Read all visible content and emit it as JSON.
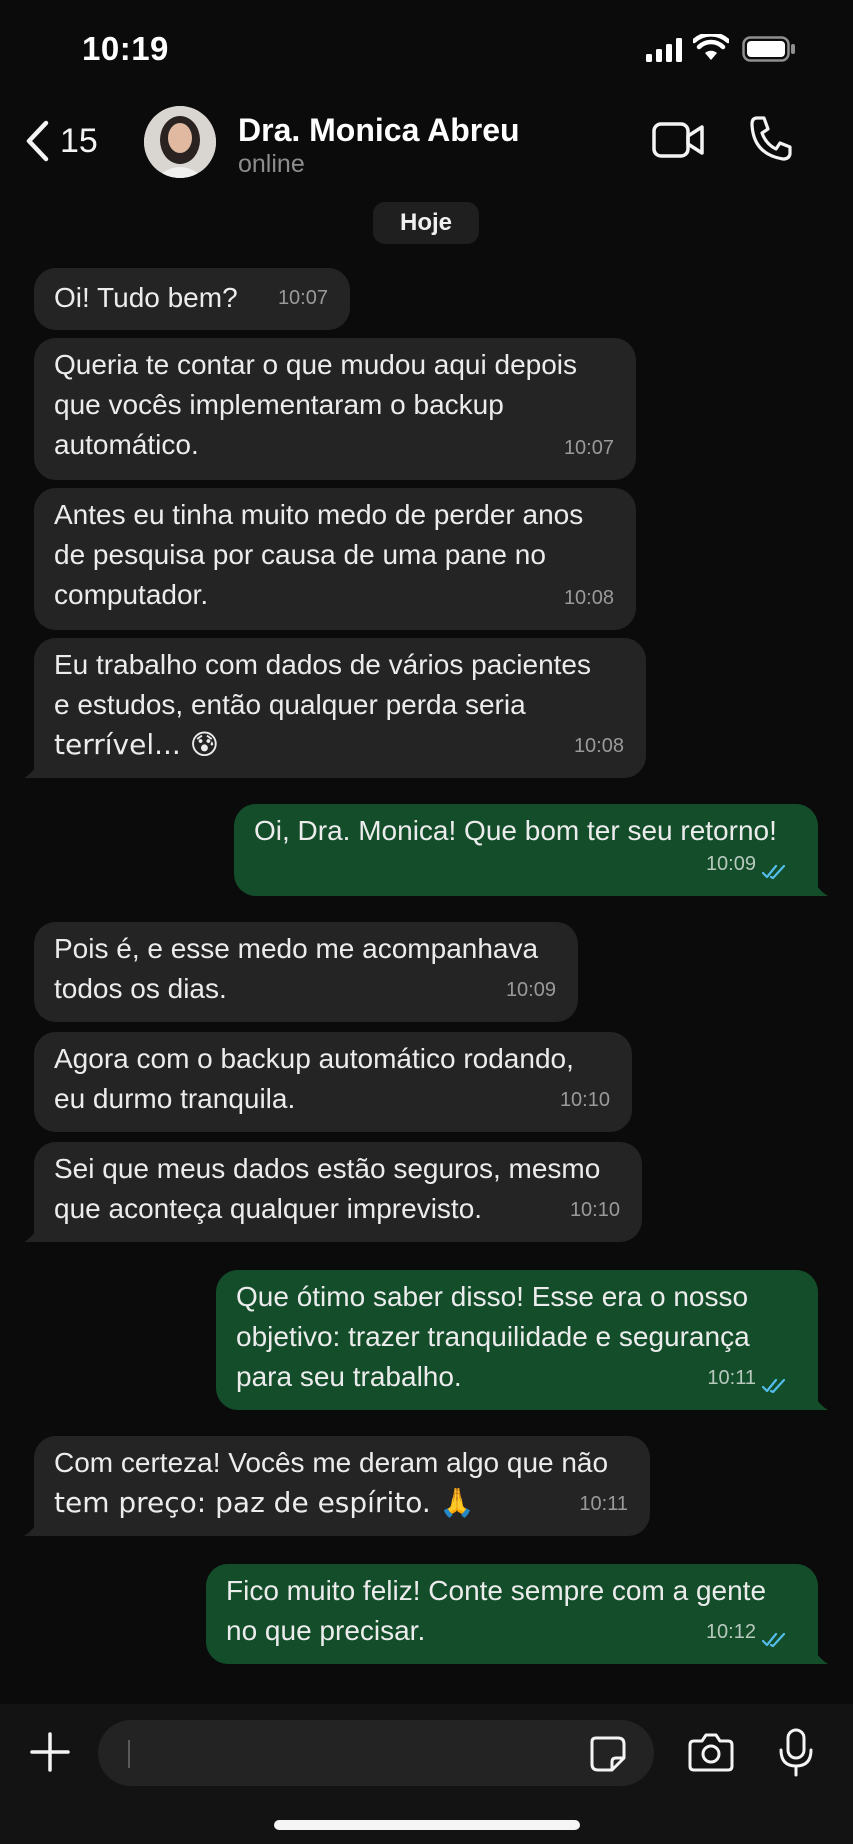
{
  "status_bar": {
    "time": "10:19"
  },
  "header": {
    "back_count": "15",
    "contact_name": "Dra. Monica Abreu",
    "contact_status": "online"
  },
  "chat": {
    "date_label": "Hoje",
    "messages": [
      {
        "dir": "in",
        "text": "Oi! Tudo bem?",
        "time": "10:07"
      },
      {
        "dir": "in",
        "lines": [
          "Queria te contar o que mudou aqui depois",
          "que vocês implementaram o backup",
          "automático."
        ],
        "time": "10:07"
      },
      {
        "dir": "in",
        "lines": [
          "Antes eu tinha muito medo de perder anos",
          "de pesquisa por causa de uma pane no",
          "computador."
        ],
        "time": "10:08"
      },
      {
        "dir": "in",
        "lines": [
          "Eu trabalho com dados de vários pacientes",
          "e estudos, então qualquer perda seria",
          "terrível... 😰"
        ],
        "time": "10:08"
      },
      {
        "dir": "out",
        "text": "Oi, Dra. Monica! Que bom ter seu retorno!",
        "time": "10:09"
      },
      {
        "dir": "in",
        "lines": [
          "Pois é, e esse medo me acompanhava",
          "todos os dias."
        ],
        "time": "10:09"
      },
      {
        "dir": "in",
        "lines": [
          "Agora com o backup automático rodando,",
          "eu durmo tranquila."
        ],
        "time": "10:10"
      },
      {
        "dir": "in",
        "lines": [
          "Sei que meus dados estão seguros, mesmo",
          "que aconteça qualquer imprevisto."
        ],
        "time": "10:10"
      },
      {
        "dir": "out",
        "lines": [
          "Que ótimo saber disso! Esse era o nosso",
          "objetivo: trazer tranquilidade e segurança",
          "para seu trabalho."
        ],
        "time": "10:11"
      },
      {
        "dir": "in",
        "lines": [
          "Com certeza! Vocês me deram algo que não",
          "tem preço: paz de espírito. 🙏"
        ],
        "time": "10:11"
      },
      {
        "dir": "out",
        "lines": [
          "Fico muito feliz! Conte sempre com a gente",
          "no que precisar."
        ],
        "time": "10:12"
      }
    ]
  },
  "input_bar": {
    "placeholder": ""
  },
  "icons": [
    "chevron-left-icon",
    "video-call-icon",
    "phone-icon",
    "plus-icon",
    "sticker-icon",
    "camera-icon",
    "microphone-icon",
    "read-receipt-icon"
  ],
  "colors": {
    "incoming_bubble": "#242424",
    "outgoing_bubble": "#134d2a",
    "read_tick": "#53bdeb"
  }
}
